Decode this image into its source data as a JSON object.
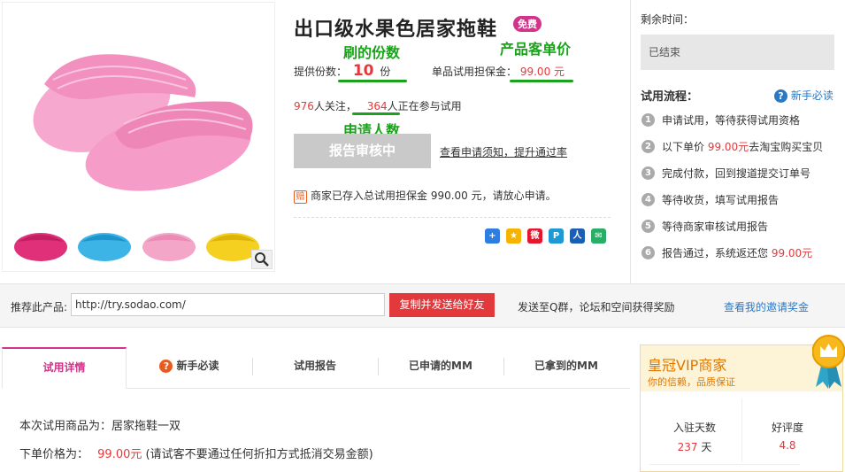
{
  "product": {
    "title": "出口级水果色居家拖鞋",
    "free_badge": "免费",
    "quota_label": "提供份数：",
    "quota_value": "10",
    "quota_unit": "份",
    "deposit_label": "单品试用担保金：",
    "deposit_value": "99.00",
    "deposit_unit": "元",
    "followers_count": "976",
    "followers_text": "人关注，",
    "participants_count": "364",
    "participants_text": "人正在参与试用",
    "apply_button": "报告审核中",
    "notice_link": "查看申请须知，提升通过率",
    "guarantee_text": "商家已存入总试用担保金 990.00 元，请放心申请。",
    "guarantee_icon": "赔"
  },
  "annotations": {
    "quota": "刷的份数",
    "price": "产品客单价",
    "applicants": "申请人数"
  },
  "gallery": {
    "zoom_icon": "magnifier-icon",
    "thumb_colors": [
      "#e0307a",
      "#3cb4e6",
      "#f4a6c8",
      "#f5d020"
    ],
    "main_color": "#f7a8cf"
  },
  "sidebar": {
    "remaining_label": "剩余时间：",
    "status": "已结束",
    "process_title": "试用流程：",
    "newbie_link": "新手必读",
    "steps": [
      {
        "num": "1",
        "text": "申请试用，等待获得试用资格",
        "highlight": "",
        "after": ""
      },
      {
        "num": "2",
        "text": "以下单价 ",
        "highlight": "99.00元",
        "after": "去淘宝购买宝贝"
      },
      {
        "num": "3",
        "text": "完成付款，回到搜道提交订单号",
        "highlight": "",
        "after": ""
      },
      {
        "num": "4",
        "text": "等待收货，填写试用报告",
        "highlight": "",
        "after": ""
      },
      {
        "num": "5",
        "text": "等待商家审核试用报告",
        "highlight": "",
        "after": ""
      },
      {
        "num": "6",
        "text": "报告通过，系统返还您 ",
        "highlight": "99.00元",
        "after": ""
      }
    ]
  },
  "share_icons": [
    {
      "name": "share-plus-icon",
      "color": "#2e7de1",
      "glyph": "+"
    },
    {
      "name": "share-qzone-icon",
      "color": "#f6b400",
      "glyph": "★"
    },
    {
      "name": "share-weibo-icon",
      "color": "#e6162d",
      "glyph": "微"
    },
    {
      "name": "share-tencent-icon",
      "color": "#1d9ad6",
      "glyph": "P"
    },
    {
      "name": "share-renren-icon",
      "color": "#1a5fb4",
      "glyph": "人"
    },
    {
      "name": "share-wechat-icon",
      "color": "#2aae67",
      "glyph": "✉"
    }
  ],
  "recommend": {
    "label": "推荐此产品:",
    "url": "http://try.sodao.com/",
    "copy_button": "复制并发送给好友",
    "reward_text": "发送至Q群，论坛和空间获得奖励",
    "invite_link": "查看我的邀请奖金"
  },
  "tabs": [
    {
      "label": "试用详情",
      "active": true
    },
    {
      "label": "新手必读",
      "active": false
    },
    {
      "label": "试用报告",
      "active": false
    },
    {
      "label": "已申请的MM",
      "active": false
    },
    {
      "label": "已拿到的MM",
      "active": false
    }
  ],
  "details": {
    "line1": "本次试用商品为：居家拖鞋一双",
    "line2_label": "下单价格为：",
    "line2_price": "99.00",
    "line2_unit": "元",
    "line2_note": "(请试客不要通过任何折扣方式抵消交易金额)"
  },
  "vip": {
    "title": "皇冠VIP商家",
    "subtitle": "你的信赖，品质保证",
    "stats": [
      {
        "label": "入驻天数",
        "value": "237",
        "unit": " 天"
      },
      {
        "label": "好评度",
        "value": "4.8",
        "unit": ""
      }
    ]
  }
}
